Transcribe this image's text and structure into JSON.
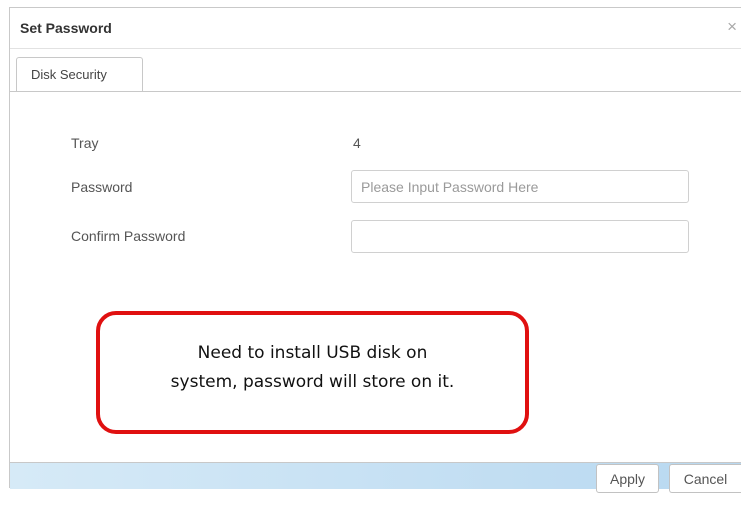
{
  "dialog": {
    "title": "Set Password",
    "close_glyph": "×"
  },
  "tabs": [
    {
      "label": "Disk Security",
      "active": true
    }
  ],
  "form": {
    "tray_label": "Tray",
    "tray_value": "4",
    "password_label": "Password",
    "password_value": "",
    "password_placeholder": "Please Input Password Here",
    "confirm_label": "Confirm Password",
    "confirm_value": "",
    "confirm_placeholder": ""
  },
  "callout": {
    "line1": "Need to install USB disk on",
    "line2": "system, password will store on it.",
    "border_color": "#e01010"
  },
  "footer": {
    "apply_label": "Apply",
    "cancel_label": "Cancel"
  },
  "icons": {
    "close": "close-icon"
  }
}
